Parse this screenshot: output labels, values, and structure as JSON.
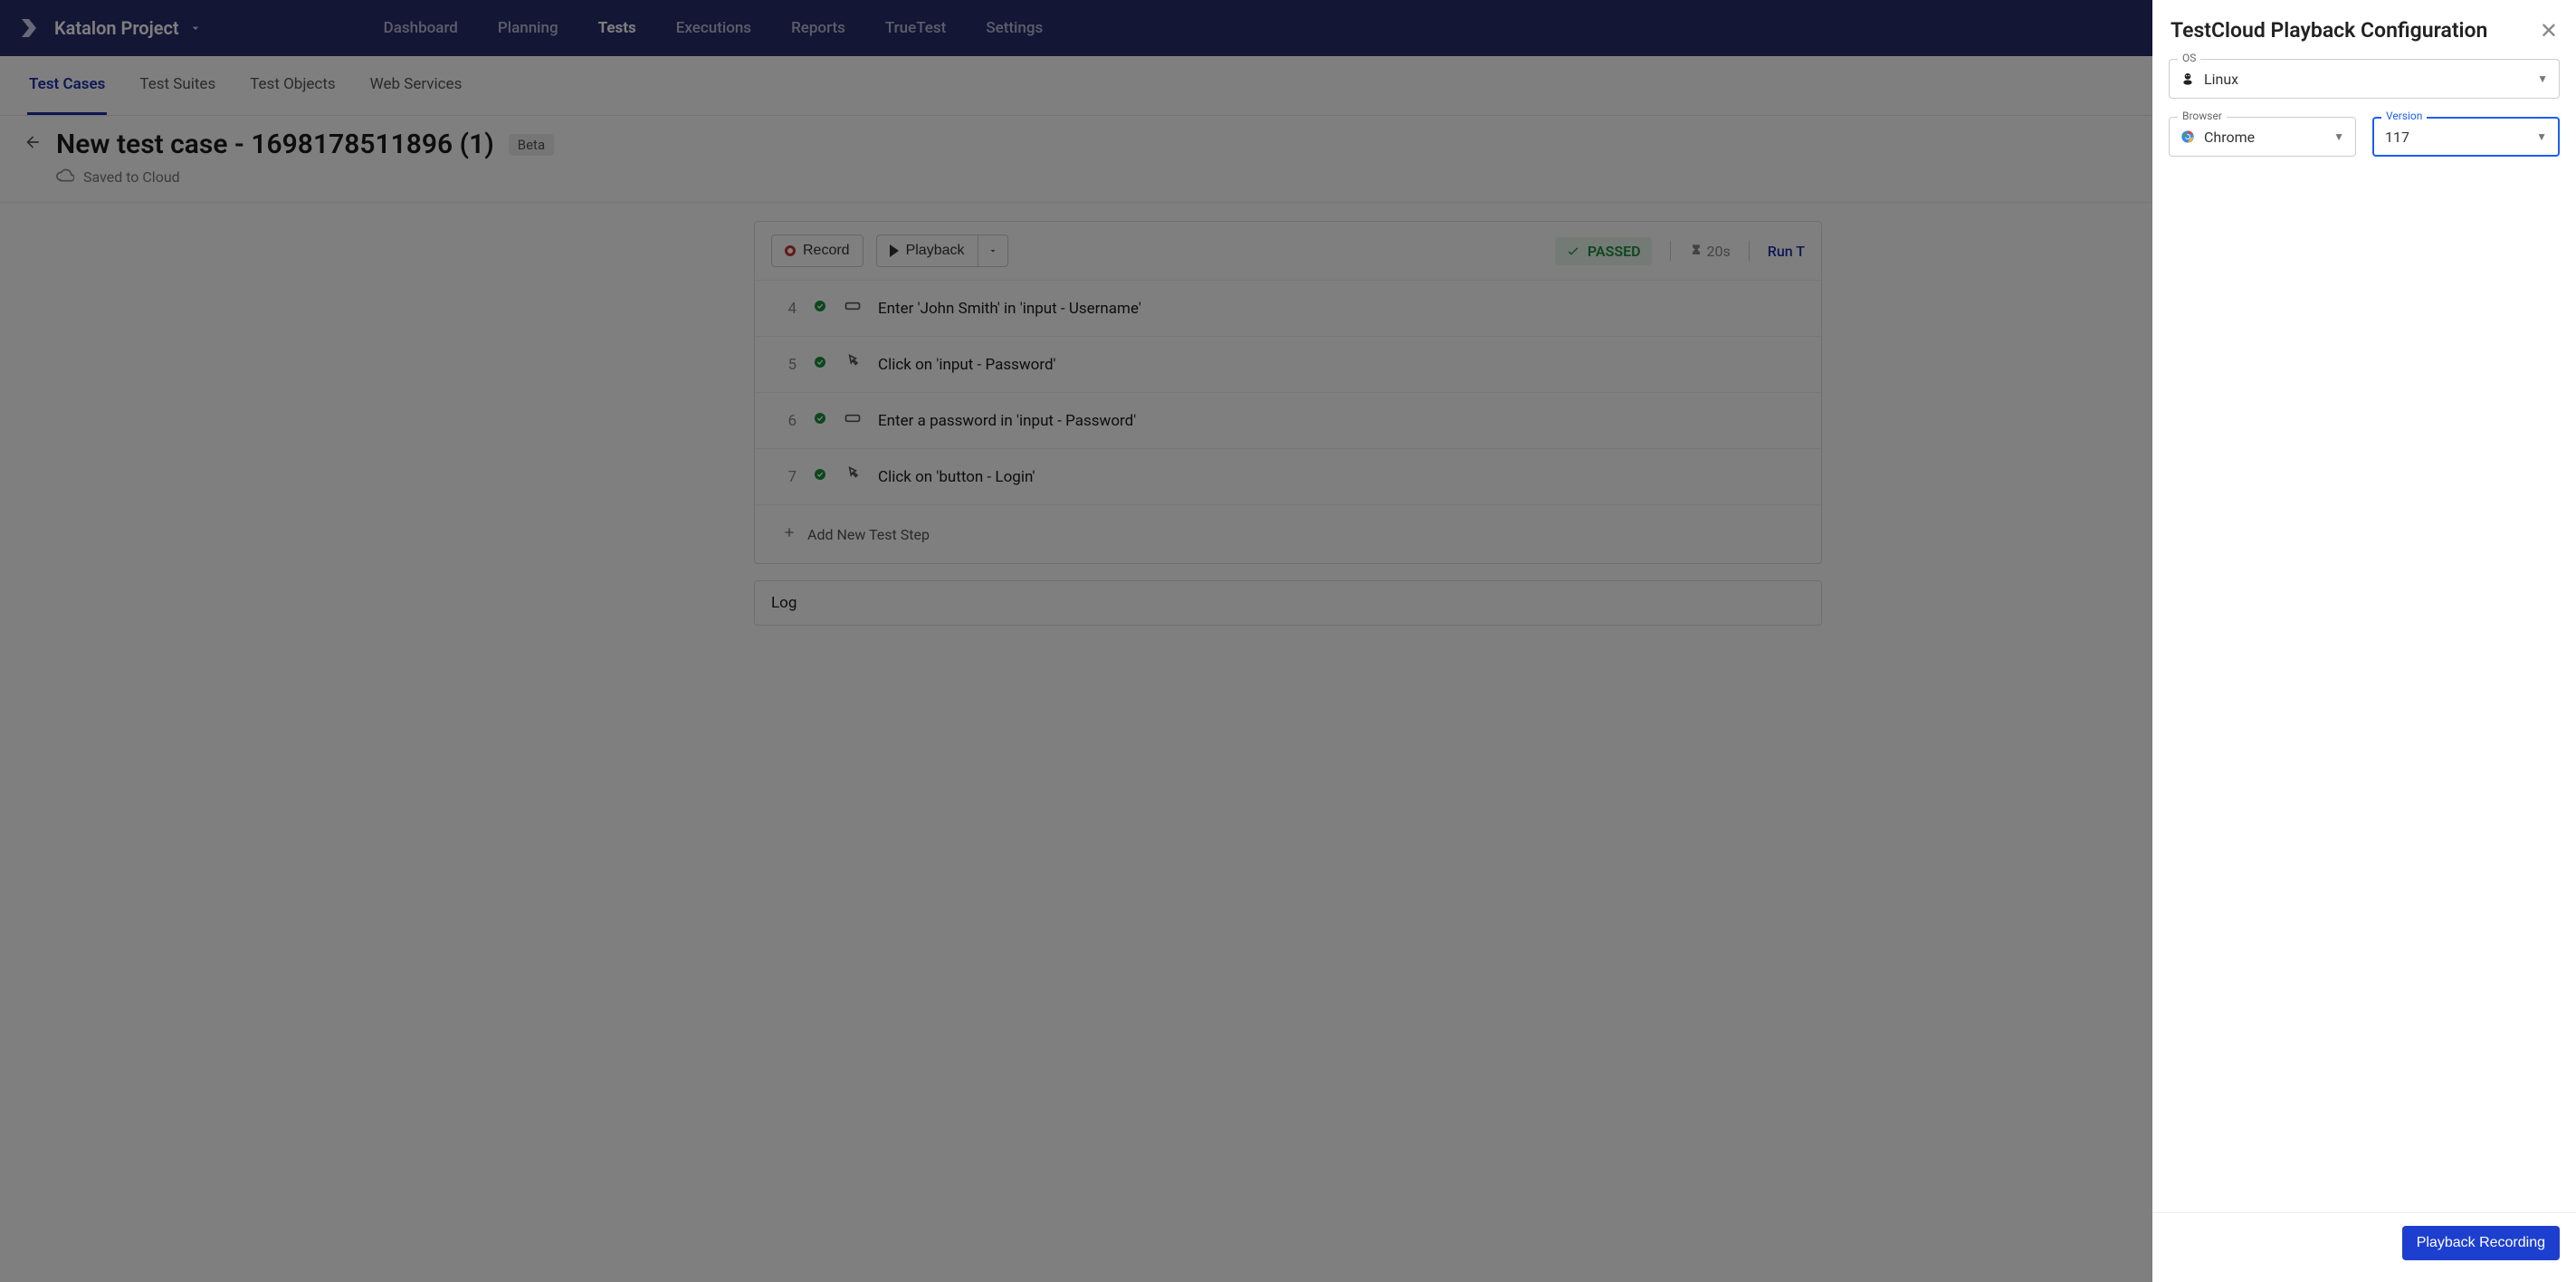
{
  "project_name": "Katalon Project",
  "topnav": {
    "dashboard": "Dashboard",
    "planning": "Planning",
    "tests": "Tests",
    "executions": "Executions",
    "reports": "Reports",
    "truetest": "TrueTest",
    "settings": "Settings"
  },
  "subtabs": {
    "cases": "Test Cases",
    "suites": "Test Suites",
    "objects": "Test Objects",
    "web": "Web Services"
  },
  "page": {
    "title": "New test case - 1698178511896 (1)",
    "badge": "Beta",
    "saved": "Saved to Cloud"
  },
  "toolbar": {
    "record": "Record",
    "playback": "Playback",
    "passed": "PASSED",
    "duration": "20s",
    "run_label": "Run T"
  },
  "steps": [
    {
      "n": "4",
      "icon": "input",
      "text": "Enter 'John Smith' in 'input - Username'"
    },
    {
      "n": "5",
      "icon": "click",
      "text": "Click on 'input - Password'"
    },
    {
      "n": "6",
      "icon": "input",
      "text": "Enter a password in 'input - Password'"
    },
    {
      "n": "7",
      "icon": "click",
      "text": "Click on 'button - Login'"
    }
  ],
  "add_step": "Add New Test Step",
  "log_label": "Log",
  "panel": {
    "title": "TestCloud Playback Configuration",
    "os_label": "OS",
    "os_value": "Linux",
    "browser_label": "Browser",
    "browser_value": "Chrome",
    "version_label": "Version",
    "version_value": "117",
    "submit": "Playback Recording"
  }
}
